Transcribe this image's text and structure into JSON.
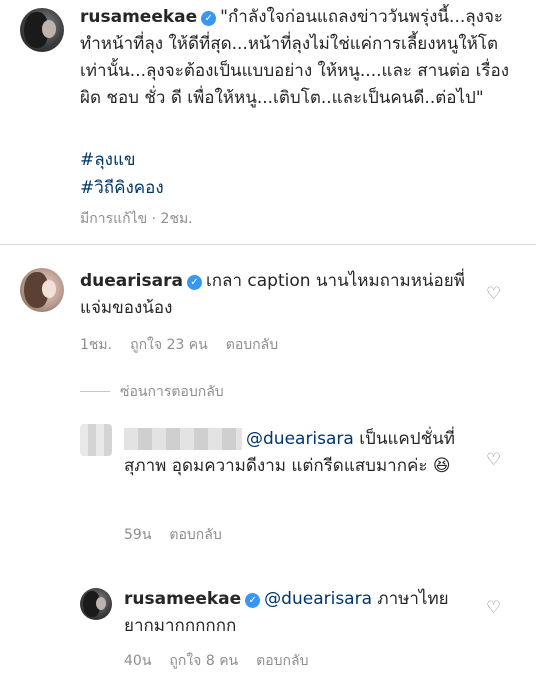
{
  "caption": {
    "username": "rusameekae",
    "text": "\"กำลังใจก่อนแถลงข่าววันพรุ่งนี้...ลุงจะทำหน้าที่ลุง ให้ดีที่สุด...หน้าที่ลุงไม่ใช่แค่การเลี้ยงหนูให้โตเท่านั้น...ลุงจะต้องเป็นแบบอย่าง ให้หนู....และ สานต่อ เรื่อง ผิด ชอบ ชั่ว ดี เพื่อให้หนู...เติบโต..และเป็นคนดี..ต่อไป\"",
    "hashtags": [
      "#ลุงแข",
      "#วิถีคิงคอง"
    ],
    "meta": "มีการแก้ไข · 2ชม."
  },
  "comment1": {
    "username": "duearisara",
    "text": "เกลา caption นานไหมถามหน่อยพี่แจ่มของน้อง",
    "time": "1ชม.",
    "likes": "ถูกใจ 23 คน",
    "reply": "ตอบกลับ"
  },
  "hide_replies": "ซ่อนการตอบกลับ",
  "reply1": {
    "mention": "@duearisara",
    "text": "เป็นแคปชั่นที่สุภาพ อุดมความดีงาม แต่กรีดแสบมากค่ะ 😆",
    "time": "59น",
    "reply": "ตอบกลับ"
  },
  "reply2": {
    "username": "rusameekae",
    "mention": "@duearisara",
    "text": "ภาษาไทยยากมากกกกกก",
    "time": "40น",
    "likes": "ถูกใจ 8 คน",
    "reply": "ตอบกลับ"
  },
  "icons": {
    "verified": "verified-badge-icon",
    "heart": "heart-outline-icon"
  },
  "colors": {
    "mention": "#00376b",
    "verified": "#3897f0",
    "meta": "#8e8e8e"
  }
}
